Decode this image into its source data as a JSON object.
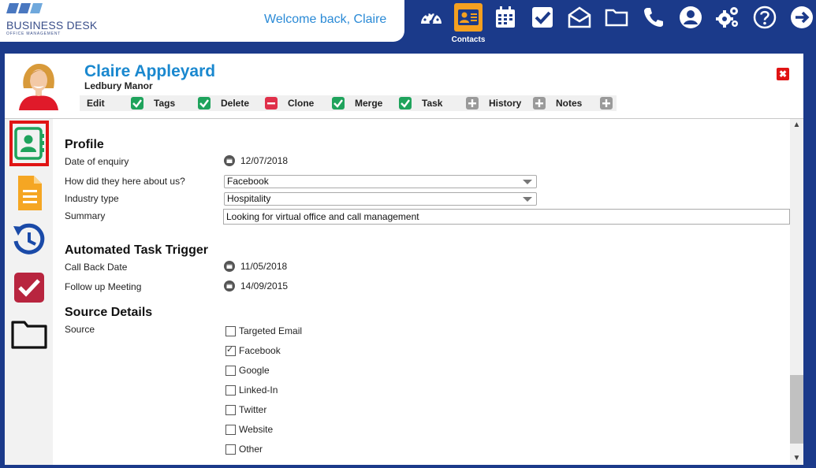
{
  "brand": {
    "name": "BUSINESS DESK",
    "tagline": "OFFICE MANAGEMENT"
  },
  "header": {
    "welcome": "Welcome back, Claire",
    "active_label": "Contacts",
    "icons": [
      "dashboard-icon",
      "contacts-icon",
      "calendar-icon",
      "tasks-icon",
      "mail-icon",
      "folder-icon",
      "phone-icon",
      "user-icon",
      "settings-icon",
      "help-icon",
      "logout-icon"
    ]
  },
  "contact": {
    "name": "Claire Appleyard",
    "company": "Ledbury Manor",
    "close_symbol": "✖",
    "actions": [
      {
        "label": "Edit",
        "status": "check"
      },
      {
        "label": "Tags",
        "status": "check"
      },
      {
        "label": "Delete",
        "status": "minus"
      },
      {
        "label": "Clone",
        "status": "check"
      },
      {
        "label": "Merge",
        "status": "check"
      },
      {
        "label": "Task",
        "status": "plus"
      },
      {
        "label": "History",
        "status": "plus"
      },
      {
        "label": "Notes",
        "status": "plus"
      }
    ]
  },
  "sidebar": {
    "items": [
      "profile-card-icon",
      "document-icon",
      "history-icon",
      "task-check-icon",
      "folder-outline-icon"
    ]
  },
  "profile": {
    "title": "Profile",
    "date_of_enquiry_label": "Date of enquiry",
    "date_of_enquiry": "12/07/2018",
    "heard_about_label": "How did they here about us?",
    "heard_about_value": "Facebook",
    "industry_label": "Industry type",
    "industry_value": "Hospitality",
    "summary_label": "Summary",
    "summary_value": "Looking for virtual office and call management"
  },
  "trigger": {
    "title": "Automated Task Trigger",
    "call_back_label": "Call Back Date",
    "call_back_value": "11/05/2018",
    "follow_up_label": "Follow up Meeting",
    "follow_up_value": "14/09/2015"
  },
  "source": {
    "title": "Source Details",
    "label": "Source",
    "options": [
      {
        "label": "Targeted Email",
        "checked": false
      },
      {
        "label": "Facebook",
        "checked": true
      },
      {
        "label": "Google",
        "checked": false
      },
      {
        "label": "Linked-In",
        "checked": false
      },
      {
        "label": "Twitter",
        "checked": false
      },
      {
        "label": "Website",
        "checked": false
      },
      {
        "label": "Other",
        "checked": false
      }
    ]
  },
  "colors": {
    "nav_bg": "#1b3a8a",
    "accent": "#1a88cf",
    "active_nav": "#f5a020",
    "close": "#e01414"
  }
}
